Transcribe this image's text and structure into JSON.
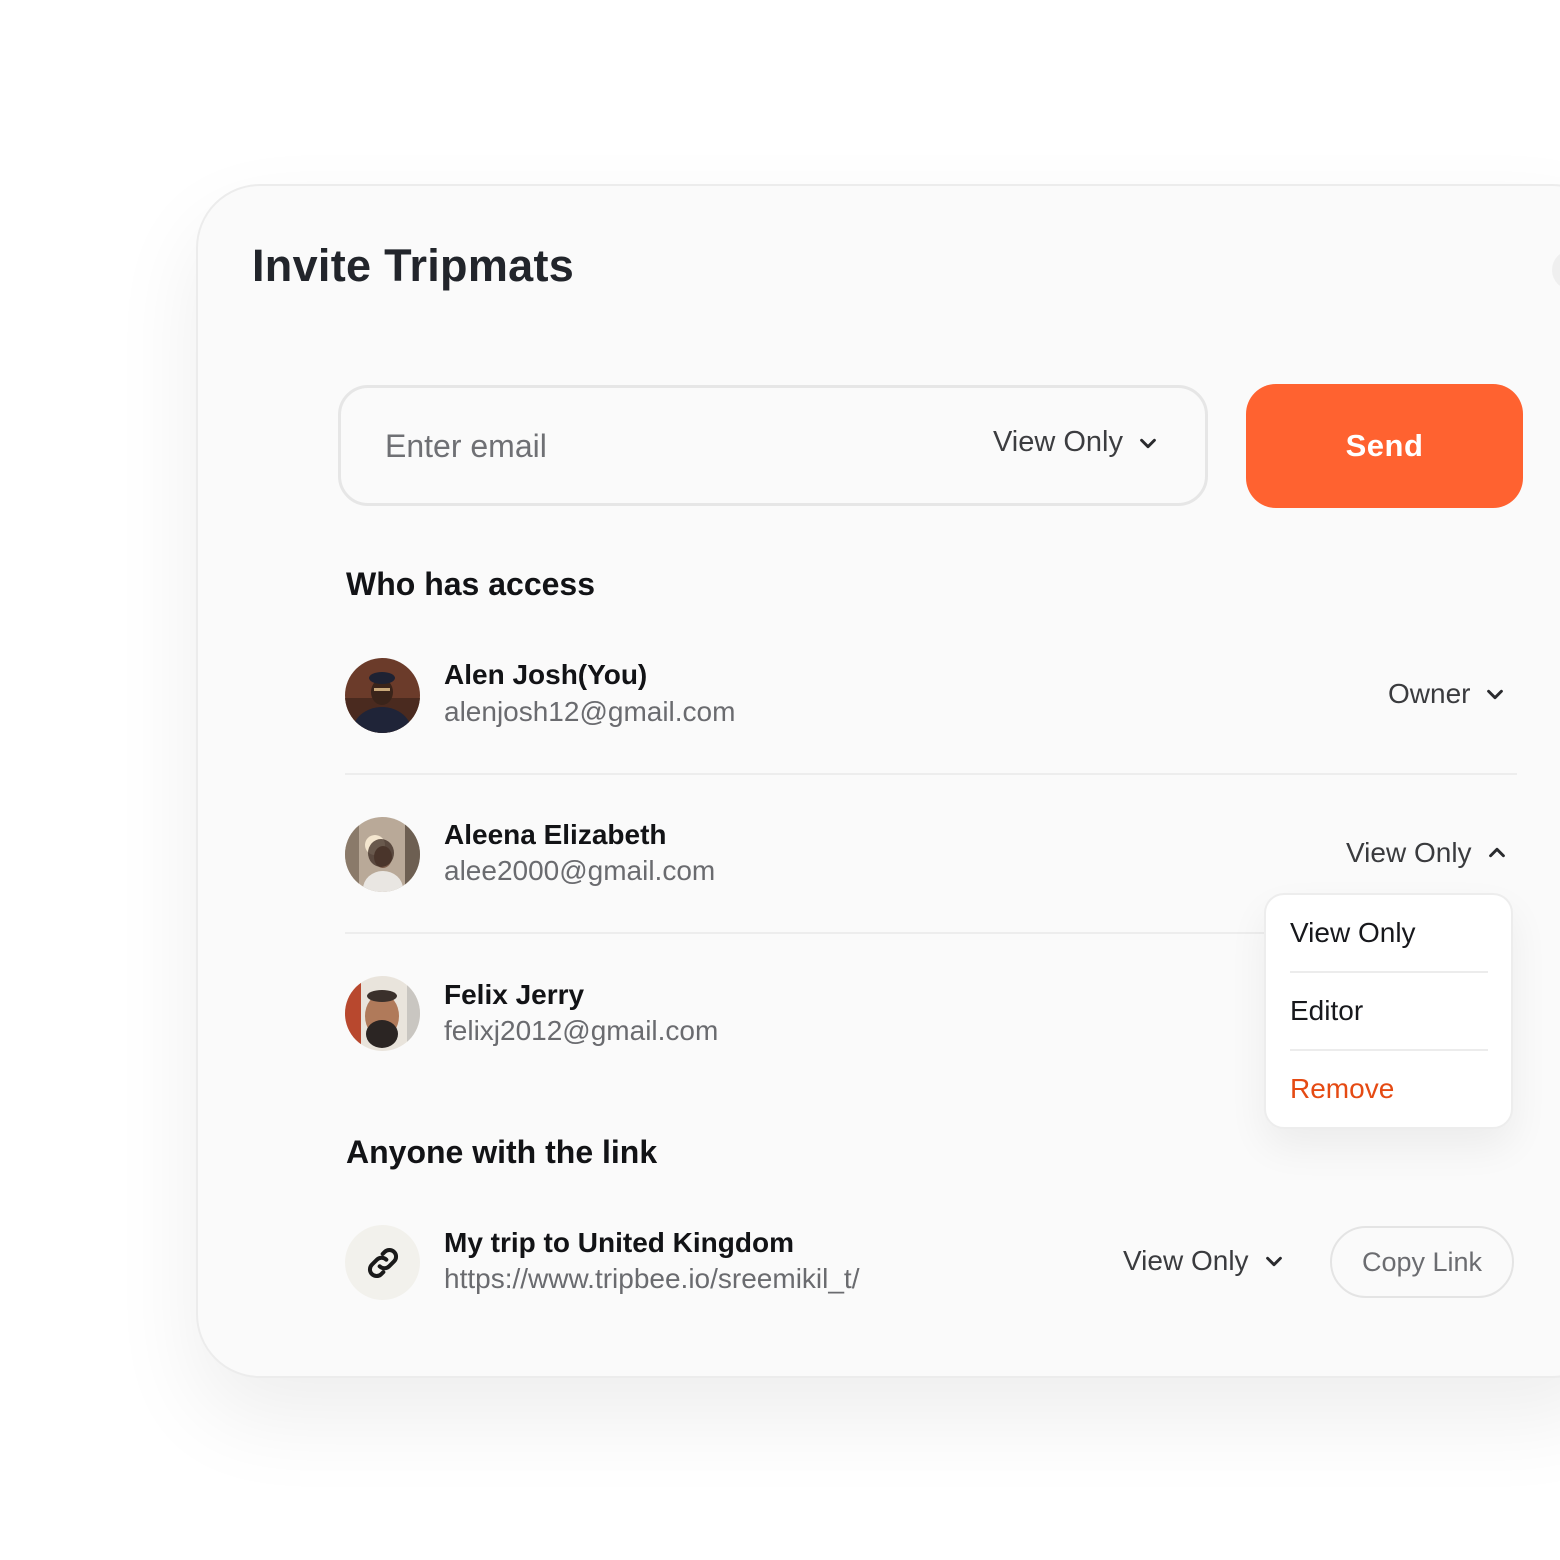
{
  "dialog": {
    "title": "Invite Tripmats"
  },
  "invite": {
    "email_placeholder": "Enter email",
    "permission": "View Only",
    "send_label": "Send"
  },
  "access": {
    "heading": "Who has access",
    "people": [
      {
        "name": "Alen Josh(You)",
        "email": "alenjosh12@gmail.com",
        "role": "Owner"
      },
      {
        "name": "Aleena Elizabeth",
        "email": "alee2000@gmail.com",
        "role": "View Only"
      },
      {
        "name": "Felix Jerry",
        "email": "felixj2012@gmail.com"
      }
    ]
  },
  "role_menu": {
    "options": [
      "View Only",
      "Editor",
      "Remove"
    ],
    "remove_color": "#e54a13"
  },
  "link_sharing": {
    "heading": "Anyone with the link",
    "trip_name": "My trip to United Kingdom",
    "url": "https://www.tripbee.io/sreemikil_t/",
    "permission": "View Only",
    "copy_label": "Copy Link"
  },
  "colors": {
    "accent": "#ff6230",
    "background": "#fafafa"
  }
}
